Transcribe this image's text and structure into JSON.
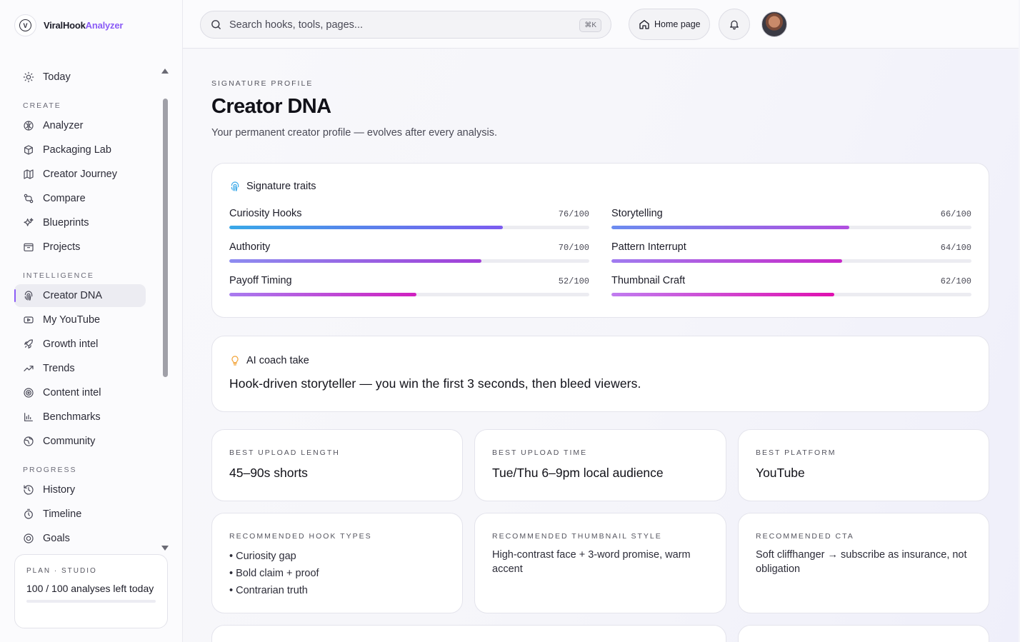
{
  "brand": {
    "name_main": "ViralHook",
    "name_accent": "Analyzer",
    "logo_letter": "V"
  },
  "sidebar": {
    "top_item": {
      "label": "Today",
      "icon": "sun-icon"
    },
    "sections": [
      {
        "title": "CREATE",
        "items": [
          {
            "label": "Analyzer",
            "icon": "brain-icon"
          },
          {
            "label": "Packaging Lab",
            "icon": "package-icon"
          },
          {
            "label": "Creator Journey",
            "icon": "map-icon"
          },
          {
            "label": "Compare",
            "icon": "compare-icon"
          },
          {
            "label": "Blueprints",
            "icon": "sparkles-icon"
          },
          {
            "label": "Projects",
            "icon": "folder-icon"
          }
        ]
      },
      {
        "title": "INTELLIGENCE",
        "items": [
          {
            "label": "Creator DNA",
            "icon": "fingerprint-icon",
            "active": true
          },
          {
            "label": "My YouTube",
            "icon": "youtube-icon"
          },
          {
            "label": "Growth intel",
            "icon": "rocket-icon"
          },
          {
            "label": "Trends",
            "icon": "trending-up-icon"
          },
          {
            "label": "Content intel",
            "icon": "target-icon"
          },
          {
            "label": "Benchmarks",
            "icon": "bar-chart-icon"
          },
          {
            "label": "Community",
            "icon": "globe-icon"
          }
        ]
      },
      {
        "title": "PROGRESS",
        "items": [
          {
            "label": "History",
            "icon": "history-icon"
          },
          {
            "label": "Timeline",
            "icon": "timer-icon"
          },
          {
            "label": "Goals",
            "icon": "goal-icon"
          }
        ]
      }
    ],
    "plan": {
      "label": "PLAN · STUDIO",
      "value": "100 / 100 analyses left today",
      "usage_fraction": 0
    }
  },
  "topbar": {
    "search_placeholder": "Search hooks, tools, pages...",
    "shortcut": "⌘K",
    "home_label": "Home page"
  },
  "page": {
    "eyebrow": "SIGNATURE PROFILE",
    "title": "Creator DNA",
    "subtitle": "Your permanent creator profile — evolves after every analysis."
  },
  "traits": {
    "title": "Signature traits",
    "items": [
      {
        "name": "Curiosity Hooks",
        "score": 76,
        "score_label": "76/100",
        "gradient": [
          "#38a8e8",
          "#7c5cf0"
        ]
      },
      {
        "name": "Storytelling",
        "score": 66,
        "score_label": "66/100",
        "gradient": [
          "#6b8cf0",
          "#b14fe0"
        ]
      },
      {
        "name": "Authority",
        "score": 70,
        "score_label": "70/100",
        "gradient": [
          "#8d8cf0",
          "#a23fd8"
        ]
      },
      {
        "name": "Pattern Interrupt",
        "score": 64,
        "score_label": "64/100",
        "gradient": [
          "#a07cf0",
          "#c828c8"
        ]
      },
      {
        "name": "Payoff Timing",
        "score": 52,
        "score_label": "52/100",
        "gradient": [
          "#a87cf0",
          "#d020c0"
        ]
      },
      {
        "name": "Thumbnail Craft",
        "score": 62,
        "score_label": "62/100",
        "gradient": [
          "#c07cf0",
          "#e010b0"
        ]
      }
    ]
  },
  "coach": {
    "title": "AI coach take",
    "text": "Hook-driven storyteller — you win the first 3 seconds, then bleed viewers."
  },
  "stats": [
    {
      "label": "BEST UPLOAD LENGTH",
      "value": "45–90s shorts"
    },
    {
      "label": "BEST UPLOAD TIME",
      "value": "Tue/Thu 6–9pm local audience"
    },
    {
      "label": "BEST PLATFORM",
      "value": "YouTube"
    }
  ],
  "recommendations": {
    "hook_types": {
      "label": "RECOMMENDED HOOK TYPES",
      "items": [
        "Curiosity gap",
        "Bold claim + proof",
        "Contrarian truth"
      ]
    },
    "thumbnail": {
      "label": "RECOMMENDED THUMBNAIL STYLE",
      "text": "High-contrast face + 3-word promise, warm accent"
    },
    "cta": {
      "label": "RECOMMENDED CTA",
      "text": "Soft cliffhanger → subscribe as insurance, not obligation"
    }
  },
  "colors": {
    "accent": "#8b5cf6",
    "coach_icon": "#f2a43a",
    "trait_icon": "#38a8e8"
  }
}
